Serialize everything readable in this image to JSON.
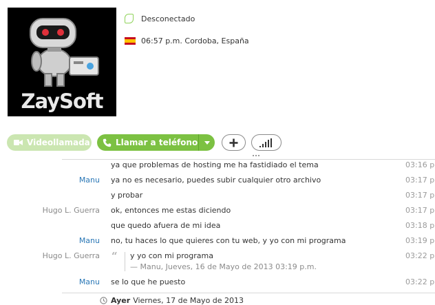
{
  "profile": {
    "avatar_caption": "ZaySoft",
    "status": "Desconectado",
    "location": "06:57 p.m. Cordoba, España"
  },
  "actions": {
    "video_label": "Videollamada",
    "call_label": "Llamar a teléfono"
  },
  "messages": [
    {
      "sender": "",
      "text": "ya que problemas de hosting me ha fastidiado el tema",
      "time": "03:16 p.",
      "self": false
    },
    {
      "sender": "Manu",
      "text": "ya no es necesario, puedes subir cualquier otro archivo",
      "time": "03:17 p.",
      "self": true
    },
    {
      "sender": "",
      "text": "y probar",
      "time": "03:17 p.",
      "self": true
    },
    {
      "sender": "Hugo L. Guerra",
      "text": "ok, entonces me estas diciendo",
      "time": "03:17 p.",
      "self": false
    },
    {
      "sender": "",
      "text": "que quedo afuera de mi idea",
      "time": "03:18 p.",
      "self": false
    },
    {
      "sender": "Manu",
      "text": "no, tu haces lo que quieres con tu web, y yo con mi programa",
      "time": "03:19 p.",
      "self": true
    }
  ],
  "quote_message": {
    "sender": "Hugo L. Guerra",
    "quote_text": "y yo con mi programa",
    "quote_attribution": "— Manu, Jueves, 16 de Mayo de 2013 03:19 p.m.",
    "time": "03:22 p."
  },
  "last_message": {
    "sender": "Manu",
    "text": "se lo que he puesto",
    "time": "03:22 p."
  },
  "day_separator": {
    "label": "Ayer",
    "date": "Viernes, 17 de Mayo de 2013"
  },
  "colors": {
    "accent_green": "#7cc142",
    "self_name": "#2a77b6",
    "other_name": "#8a8a8a"
  }
}
